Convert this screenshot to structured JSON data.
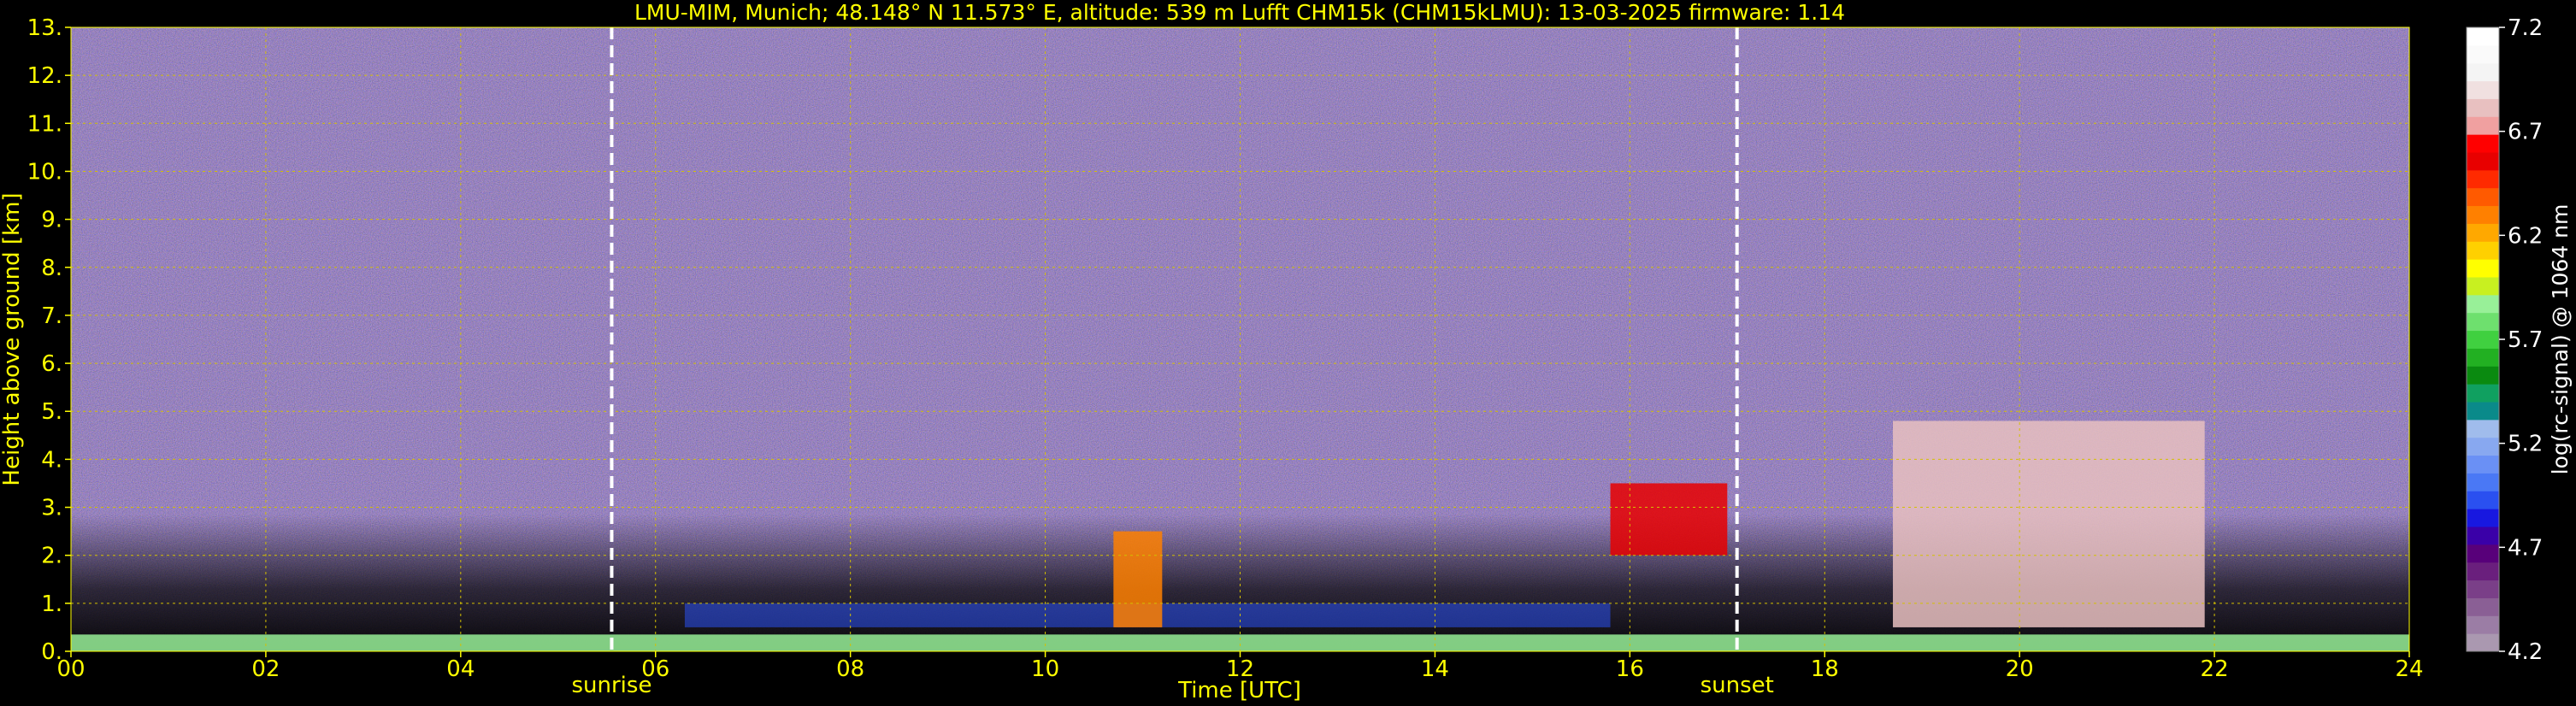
{
  "chart_data": {
    "type": "heatmap",
    "title": "LMU-MIM, Munich; 48.148° N 11.573° E, altitude: 539 m    Lufft CHM15k (CHM15kLMU): 13-03-2025    firmware: 1.14",
    "xlabel": "Time [UTC]",
    "ylabel": "Height above ground [km]",
    "xlim": [
      0,
      24
    ],
    "ylim": [
      0,
      13
    ],
    "x_ticks": [
      "00",
      "02",
      "04",
      "06",
      "08",
      "10",
      "12",
      "14",
      "16",
      "18",
      "20",
      "22",
      "24"
    ],
    "x_tick_values": [
      0,
      2,
      4,
      6,
      8,
      10,
      12,
      14,
      16,
      18,
      20,
      22,
      24
    ],
    "y_ticks": [
      "0.",
      "1.",
      "2.",
      "3.",
      "4.",
      "5.",
      "6.",
      "7.",
      "8.",
      "9.",
      "10.",
      "11.",
      "12.",
      "13."
    ],
    "y_tick_values": [
      0,
      1,
      2,
      3,
      4,
      5,
      6,
      7,
      8,
      9,
      10,
      11,
      12,
      13
    ],
    "grid": true,
    "markers": [
      {
        "label": "sunrise",
        "time": 5.55
      },
      {
        "label": "sunset",
        "time": 17.1
      }
    ],
    "features": [
      {
        "kind": "surface layer",
        "t0": 0,
        "t1": 24,
        "h0": 0,
        "h1": 0.35,
        "level": 5.9
      },
      {
        "kind": "aerosol layer",
        "t0": 6.3,
        "t1": 15.8,
        "h0": 0.5,
        "h1": 1.0,
        "level": 4.9
      },
      {
        "kind": "cloud",
        "t0": 10.7,
        "t1": 11.2,
        "h0": 0.5,
        "h1": 2.5,
        "level": 6.3
      },
      {
        "kind": "cloud",
        "t0": 15.8,
        "t1": 17.0,
        "h0": 2.0,
        "h1": 3.5,
        "level": 6.6
      },
      {
        "kind": "cloud",
        "t0": 18.7,
        "t1": 21.9,
        "h0": 0.5,
        "h1": 4.8,
        "level": 6.8
      }
    ],
    "colorbar": {
      "label": "log(rc-signal) @ 1064 nm",
      "min": 4.2,
      "max": 7.2,
      "ticks": [
        "4.2",
        "4.7",
        "5.2",
        "5.7",
        "6.2",
        "6.7",
        "7.2"
      ],
      "tick_values": [
        4.2,
        4.7,
        5.2,
        5.7,
        6.2,
        6.7,
        7.2
      ],
      "colors": [
        "#aa98b0",
        "#9b7da5",
        "#8a5f95",
        "#7a3f88",
        "#6a1f7d",
        "#58007a",
        "#3a00a8",
        "#1818e0",
        "#2a50f0",
        "#4a78f5",
        "#6a90f5",
        "#88a8f0",
        "#a0bcec",
        "#0a8a8a",
        "#10a060",
        "#0a8a10",
        "#22b022",
        "#40d040",
        "#6ee06e",
        "#98f098",
        "#c8f020",
        "#ffff00",
        "#ffd000",
        "#ffa800",
        "#ff8000",
        "#ff5a00",
        "#ff2a00",
        "#e80000",
        "#ff0000",
        "#f0a0a0",
        "#e8c0c0",
        "#f0e0e0",
        "#f4f4f4",
        "#fafafa",
        "#ffffff"
      ]
    }
  }
}
